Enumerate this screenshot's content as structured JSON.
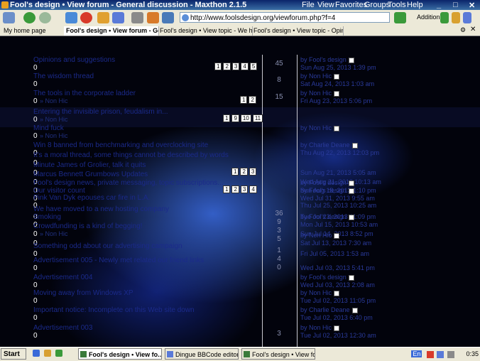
{
  "window": {
    "title": "Fool's design • View forum - General discussion - Maxthon 2.1.5"
  },
  "menu": [
    "File",
    "View",
    "Favorites",
    "Groups",
    "Tools",
    "Help"
  ],
  "toolbar": {
    "address": "http://www.foolsdesign.org/viewforum.php?f=4",
    "addition_label": "Addition"
  },
  "tabs": [
    {
      "label": "My home page"
    },
    {
      "label": "Fool's design • View forum - Gen...",
      "active": true
    },
    {
      "label": "Fool's design • View topic - We have..."
    },
    {
      "label": "Fool's design • View topic - Opinions ..."
    }
  ],
  "topics": [
    {
      "title": "Opinions and suggestions",
      "sub": "",
      "pages": [
        "1",
        "2",
        "3",
        "4",
        "5"
      ],
      "count": "45",
      "by": "by Fool's design",
      "date": "Sun Aug 25, 2013 1:39 pm"
    },
    {
      "title": "The wisdom thread",
      "sub": "",
      "pages": [],
      "count": "8",
      "by": "by Non Hic",
      "date": "Sat Aug 24, 2013 1:03 am"
    },
    {
      "title": "The tools in the corporate ladder",
      "sub": "» Non Hic",
      "pages": [
        "1",
        "2"
      ],
      "count": "15",
      "by": "by Non Hic",
      "date": "Fri Aug 23, 2013 5:06 pm"
    },
    {
      "title": "Entering the invisible prison, feudalism in...",
      "sub": "» Non Hic",
      "pages": [
        "1",
        "9",
        "10",
        "11"
      ],
      "count": "",
      "by": "",
      "date": ""
    },
    {
      "title": "Mind fuck",
      "sub": "» Non Hic",
      "pages": [],
      "count": "",
      "by": "by Non Hic",
      "date": ""
    },
    {
      "title": "Win 8 banned from benchmarking and overclocking site",
      "sub": "",
      "pages": [],
      "count": "",
      "by": "by Charlie Deane",
      "date": "Thu Aug 22, 2013 12:03 pm"
    },
    {
      "title": "It's a moral thread, some things cannot be described by words",
      "sub": "",
      "pages": [],
      "count": "",
      "by": "",
      "date": ""
    },
    {
      "title": "Minute James of Grolier, talk it quits",
      "sub": "",
      "pages": [
        "1",
        "2",
        "3"
      ],
      "count": "",
      "by": "",
      "date": "Sun Aug 21, 2013 5:05 am"
    },
    {
      "title": "Marcus Bennett Grumbows Updates",
      "sub": "",
      "pages": [],
      "count": "",
      "by": "",
      "date": "Wed Aug 21, 2013 10:13 am"
    },
    {
      "title": "Fool's design news, private messaging, topic subscriptions...",
      "sub": "",
      "pages": [
        "1",
        "2",
        "3",
        "4"
      ],
      "count": "",
      "by": "by Fool's design",
      "date": "Sun Aug 18, 2013 1:10 pm"
    },
    {
      "title": "Our visitor count",
      "sub": "",
      "pages": [],
      "count": "",
      "by": "by Fool's design",
      "date": "Wed Jul 31, 2013 9:55 am"
    },
    {
      "title": "Pink Van Dyk epouses car fire in L.A.",
      "sub": "",
      "pages": [],
      "count": "",
      "by": "",
      "date": "Thu Jul 25, 2013 10:25 am"
    },
    {
      "title": "We have moved to a new hosting company",
      "sub": "",
      "pages": [],
      "count": "",
      "by": "",
      "date": "Tue Jul 23, 2013 11:09 pm"
    },
    {
      "title": "Smoking",
      "sub": "",
      "pages": [],
      "count": "",
      "by": "by Fool's design",
      "date": "Mon Jul 15, 2013 10:53 am"
    },
    {
      "title": "Crowdfunding is a kind of begging!",
      "sub": "» Non Hic",
      "pages": [],
      "count": "",
      "by": "",
      "date": "Sun Jul 14, 2013 8:52 pm"
    },
    {
      "title": "",
      "sub": "",
      "pages": [],
      "count": "",
      "by": "by Non Hic",
      "date": "Sat Jul 13, 2013 7:30 am"
    },
    {
      "title": "Something odd about our advertising campaign",
      "sub": "",
      "pages": [],
      "count": "",
      "by": "",
      "date": "Fri Jul 05, 2013 1:53 am"
    },
    {
      "title": "Advertisement 005 - Newly met related our friend links",
      "sub": "",
      "pages": [],
      "count": "",
      "by": "",
      "date": "Wed Jul 03, 2013 5:41 pm"
    },
    {
      "title": "Advertisement 004",
      "sub": "",
      "pages": [],
      "count": "",
      "by": "by Fool's design",
      "date": "Wed Jul 03, 2013 2:08 am"
    },
    {
      "title": "Moving away from Windows XP",
      "sub": "",
      "pages": [],
      "count": "",
      "by": "by Non Hic",
      "date": "Tue Jul 02, 2013 11:05 pm"
    },
    {
      "title": "Important notice: Incomplete on this Web site down",
      "sub": "",
      "pages": [],
      "count": "",
      "by": "by Charlie Deane",
      "date": "Tue Jul 02, 2013 6:40 pm"
    },
    {
      "title": "Advertisement 003",
      "sub": "",
      "pages": [],
      "count": "",
      "by": "by Non Hic",
      "date": "Tue Jul 02, 2013 12:30 am"
    }
  ],
  "counts_column": [
    "45",
    "8",
    "15",
    "",
    "",
    "",
    "",
    "",
    "36",
    "9",
    "3",
    "5",
    "1",
    "4",
    "0",
    "",
    "",
    "",
    "",
    "",
    "",
    "3"
  ],
  "taskbar": {
    "start": "Start",
    "tasks": [
      {
        "label": "Fool's design • View fo...",
        "active": true
      },
      {
        "label": "Dingue BBCode editor 0.8"
      },
      {
        "label": "Fool's design • View foru..."
      }
    ],
    "lang": "En",
    "clock": "0:35"
  }
}
